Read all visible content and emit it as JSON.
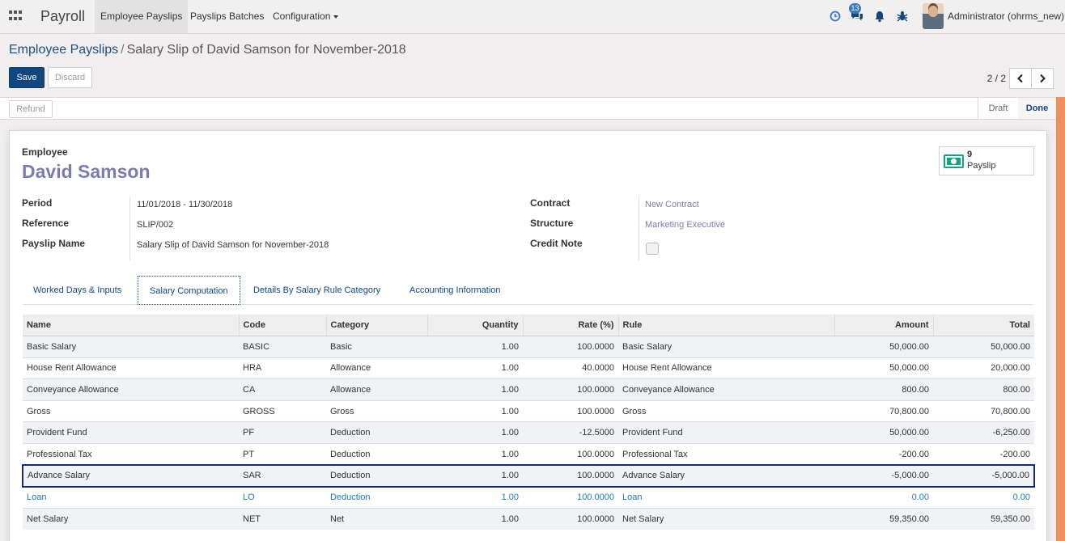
{
  "topbar": {
    "app_name": "Payroll",
    "menu": [
      "Employee Payslips",
      "Payslips Batches",
      "Configuration"
    ],
    "notification_count": "13",
    "user_name": "Administrator (ohrms_new)"
  },
  "breadcrumb": {
    "parent": "Employee Payslips",
    "separator": "/",
    "current": "Salary Slip of David Samson for November-2018"
  },
  "buttons": {
    "save": "Save",
    "discard": "Discard",
    "refund": "Refund"
  },
  "pager": {
    "value": "2 / 2"
  },
  "status": {
    "stages": [
      "Draft",
      "Done"
    ],
    "active": "Done"
  },
  "employee": {
    "label": "Employee",
    "name": "David Samson"
  },
  "smart_button": {
    "count": "9",
    "label": "Payslip"
  },
  "fields_left": [
    {
      "label": "Period",
      "value": "11/01/2018 - 11/30/2018"
    },
    {
      "label": "Reference",
      "value": "SLIP/002"
    },
    {
      "label": "Payslip Name",
      "value": "Salary Slip of David Samson for November-2018"
    }
  ],
  "fields_right": [
    {
      "label": "Contract",
      "value": "New Contract"
    },
    {
      "label": "Structure",
      "value": "Marketing Executive"
    },
    {
      "label": "Credit Note",
      "value": false
    }
  ],
  "tabs": [
    "Worked Days & Inputs",
    "Salary Computation",
    "Details By Salary Rule Category",
    "Accounting Information"
  ],
  "active_tab": "Salary Computation",
  "table": {
    "columns": [
      "Name",
      "Code",
      "Category",
      "Quantity",
      "Rate (%)",
      "Rule",
      "Amount",
      "Total"
    ],
    "rows": [
      [
        "Basic Salary",
        "BASIC",
        "Basic",
        "1.00",
        "100.0000",
        "Basic Salary",
        "50,000.00",
        "50,000.00"
      ],
      [
        "House Rent Allowance",
        "HRA",
        "Allowance",
        "1.00",
        "40.0000",
        "House Rent Allowance",
        "50,000.00",
        "20,000.00"
      ],
      [
        "Conveyance Allowance",
        "CA",
        "Allowance",
        "1.00",
        "100.0000",
        "Conveyance Allowance",
        "800.00",
        "800.00"
      ],
      [
        "Gross",
        "GROSS",
        "Gross",
        "1.00",
        "100.0000",
        "Gross",
        "70,800.00",
        "70,800.00"
      ],
      [
        "Provident Fund",
        "PF",
        "Deduction",
        "1.00",
        "-12.5000",
        "Provident Fund",
        "50,000.00",
        "-6,250.00"
      ],
      [
        "Professional Tax",
        "PT",
        "Deduction",
        "1.00",
        "100.0000",
        "Professional Tax",
        "-200.00",
        "-200.00"
      ],
      [
        "Advance Salary",
        "SAR",
        "Deduction",
        "1.00",
        "100.0000",
        "Advance Salary",
        "-5,000.00",
        "-5,000.00"
      ],
      [
        "Loan",
        "LO",
        "Deduction",
        "1.00",
        "100.0000",
        "Loan",
        "0.00",
        "0.00"
      ],
      [
        "Net Salary",
        "NET",
        "Net",
        "1.00",
        "100.0000",
        "Net Salary",
        "59,350.00",
        "59,350.00"
      ]
    ],
    "selected_row": "Advance Salary",
    "highlighted_row": "Loan"
  },
  "colors": {
    "primary": "#13467f",
    "link": "#7c7bad",
    "loan_text": "#1f77b4",
    "status_strip": "#ee9060"
  }
}
